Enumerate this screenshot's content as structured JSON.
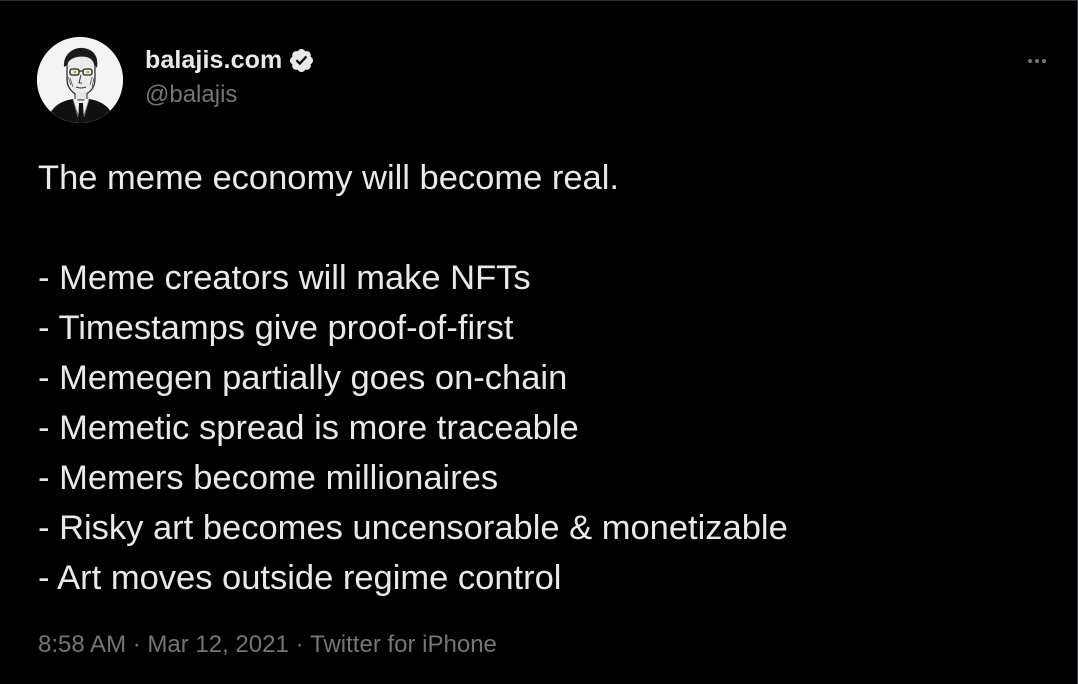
{
  "author": {
    "display_name": "balajis.com",
    "handle": "@balajis",
    "verified": true,
    "avatar_icon": "sketch-portrait-avatar"
  },
  "menu": {
    "more_icon": "more-horizontal-icon"
  },
  "tweet": {
    "headline": "The meme economy will become real.",
    "lines": [
      "- Meme creators will make NFTs",
      "- Timestamps give proof-of-first",
      "- Memegen partially goes on-chain",
      "- Memetic spread is more traceable",
      "- Memers become millionaires",
      "- Risky art becomes uncensorable & monetizable",
      "- Art moves outside regime control"
    ]
  },
  "meta": {
    "time": "8:58 AM",
    "separator": " · ",
    "date": "Mar 12, 2021",
    "source": "Twitter for iPhone"
  },
  "colors": {
    "background": "#000000",
    "text_primary": "#e7e9ea",
    "text_secondary": "#71767b",
    "verified_badge": "#e7e9ea"
  }
}
